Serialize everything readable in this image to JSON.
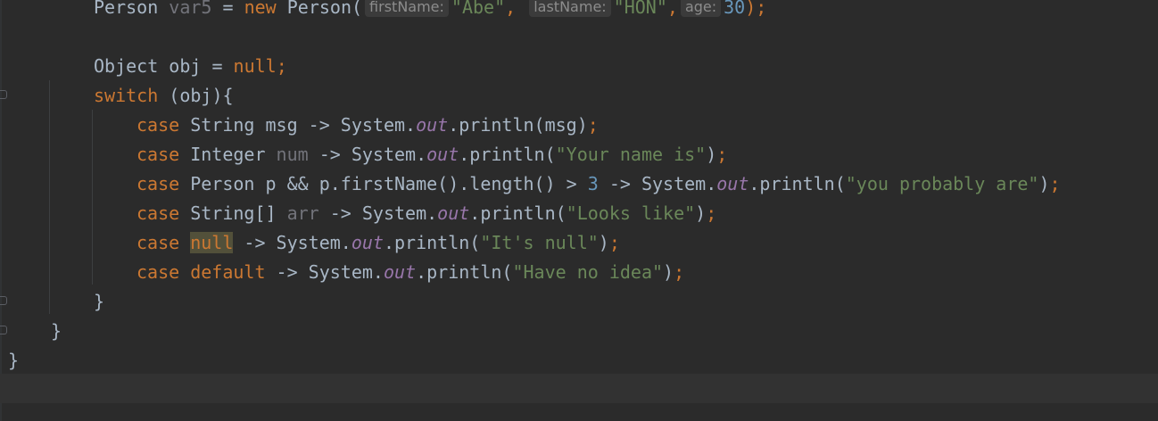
{
  "editor": {
    "lines": [
      {
        "id": "var5",
        "tokens": [
          {
            "t": "Person ",
            "c": ""
          },
          {
            "t": "var5",
            "c": "unused"
          },
          {
            "t": " = ",
            "c": ""
          },
          {
            "t": "new",
            "c": "kw"
          },
          {
            "t": " Person(",
            "c": ""
          },
          {
            "t": "firstName:",
            "c": "hint"
          },
          {
            "t": "\"Abe\"",
            "c": "str"
          },
          {
            "t": ", ",
            "c": "kw"
          },
          {
            "t": "lastName:",
            "c": "hint"
          },
          {
            "t": "\"HON\"",
            "c": "str"
          },
          {
            "t": ",",
            "c": "kw"
          },
          {
            "t": "age:",
            "c": "hint"
          },
          {
            "t": "30",
            "c": "num"
          },
          {
            "t": ");",
            "c": "kw"
          }
        ]
      },
      {
        "id": "obj",
        "tokens": [
          {
            "t": "Object obj = ",
            "c": ""
          },
          {
            "t": "null",
            "c": "kw"
          },
          {
            "t": ";",
            "c": "kw"
          }
        ]
      },
      {
        "id": "switch",
        "tokens": [
          {
            "t": "switch",
            "c": "kw"
          },
          {
            "t": " (obj){",
            "c": ""
          }
        ]
      },
      {
        "id": "case-string",
        "tokens": [
          {
            "t": "case",
            "c": "kw"
          },
          {
            "t": " String msg -> System.",
            "c": ""
          },
          {
            "t": "out",
            "c": "fld"
          },
          {
            "t": ".println(msg)",
            "c": ""
          },
          {
            "t": ";",
            "c": "kw"
          }
        ]
      },
      {
        "id": "case-integer",
        "tokens": [
          {
            "t": "case",
            "c": "kw"
          },
          {
            "t": " Integer ",
            "c": ""
          },
          {
            "t": "num",
            "c": "unused"
          },
          {
            "t": " -> System.",
            "c": ""
          },
          {
            "t": "out",
            "c": "fld"
          },
          {
            "t": ".println(",
            "c": ""
          },
          {
            "t": "\"Your name is\"",
            "c": "str"
          },
          {
            "t": ")",
            "c": ""
          },
          {
            "t": ";",
            "c": "kw"
          }
        ]
      },
      {
        "id": "case-person",
        "tokens": [
          {
            "t": "case",
            "c": "kw"
          },
          {
            "t": " Person p && p.firstName().length() > ",
            "c": ""
          },
          {
            "t": "3",
            "c": "num"
          },
          {
            "t": " -> System.",
            "c": ""
          },
          {
            "t": "out",
            "c": "fld"
          },
          {
            "t": ".println(",
            "c": ""
          },
          {
            "t": "\"you probably are\"",
            "c": "str"
          },
          {
            "t": ")",
            "c": ""
          },
          {
            "t": ";",
            "c": "kw"
          }
        ]
      },
      {
        "id": "case-array",
        "tokens": [
          {
            "t": "case",
            "c": "kw"
          },
          {
            "t": " String[] ",
            "c": ""
          },
          {
            "t": "arr",
            "c": "unused"
          },
          {
            "t": " -> System.",
            "c": ""
          },
          {
            "t": "out",
            "c": "fld"
          },
          {
            "t": ".println(",
            "c": ""
          },
          {
            "t": "\"Looks like\"",
            "c": "str"
          },
          {
            "t": ")",
            "c": ""
          },
          {
            "t": ";",
            "c": "kw"
          }
        ]
      },
      {
        "id": "case-null",
        "tokens": [
          {
            "t": "case",
            "c": "kw"
          },
          {
            "t": " ",
            "c": ""
          },
          {
            "t": "null",
            "c": "kw hl"
          },
          {
            "t": " -> System.",
            "c": ""
          },
          {
            "t": "out",
            "c": "fld"
          },
          {
            "t": ".println(",
            "c": ""
          },
          {
            "t": "\"It's null\"",
            "c": "str"
          },
          {
            "t": ")",
            "c": ""
          },
          {
            "t": ";",
            "c": "kw"
          }
        ]
      },
      {
        "id": "case-default",
        "tokens": [
          {
            "t": "case",
            "c": "kw"
          },
          {
            "t": " ",
            "c": ""
          },
          {
            "t": "default",
            "c": "kw"
          },
          {
            "t": " -> System.",
            "c": ""
          },
          {
            "t": "out",
            "c": "fld"
          },
          {
            "t": ".println(",
            "c": ""
          },
          {
            "t": "\"Have no idea\"",
            "c": "str"
          },
          {
            "t": ")",
            "c": ""
          },
          {
            "t": ";",
            "c": "kw"
          }
        ]
      },
      {
        "id": "close-switch",
        "tokens": [
          {
            "t": "}",
            "c": ""
          }
        ]
      },
      {
        "id": "close-method",
        "tokens": [
          {
            "t": "}",
            "c": ""
          }
        ]
      },
      {
        "id": "close-class",
        "tokens": [
          {
            "t": "}",
            "c": ""
          }
        ]
      }
    ]
  },
  "colors": {
    "background": "#2b2b2b",
    "text": "#a9b7c6",
    "keyword": "#cc7832",
    "number": "#6897bb",
    "string": "#6a8759",
    "unused": "#72737a",
    "static_field": "#9876aa",
    "current_line": "#323232"
  }
}
